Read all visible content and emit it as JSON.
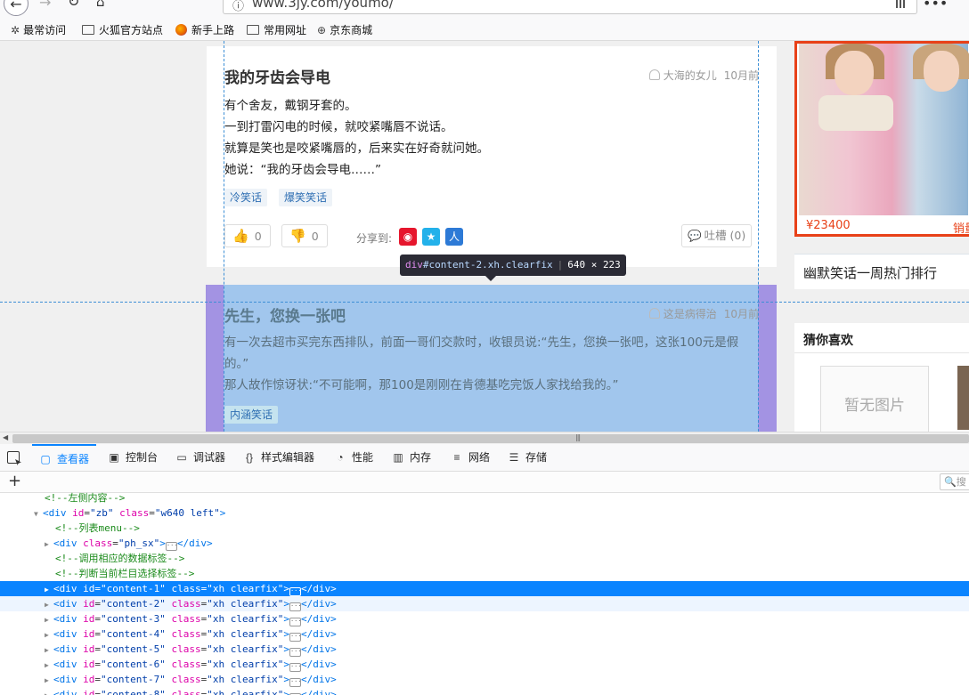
{
  "browser": {
    "url": "www.3jy.com/youmo/",
    "bookmarks": [
      "最常访问",
      "火狐官方站点",
      "新手上路",
      "常用网址",
      "京东商城"
    ]
  },
  "jokes": [
    {
      "title": "我的牙齿会导电",
      "author": "大海的女儿",
      "time": "10月前",
      "lines": [
        "有个舍友，戴钢牙套的。",
        "一到打雷闪电的时候，就咬紧嘴唇不说话。",
        "就算是笑也是咬紧嘴唇的，后来实在好奇就问她。",
        "她说：“我的牙齿会导电……”"
      ],
      "tags": [
        "冷笑话",
        "爆笑笑话"
      ],
      "likes": "0",
      "dislikes": "0",
      "share_label": "分享到:",
      "comment_label": "吐槽 (0)"
    },
    {
      "title": "先生，您换一张吧",
      "author": "这是病得治",
      "time": "10月前",
      "lines": [
        "有一次去超市买完东西排队，前面一哥们交款时，收银员说:“先生，您换一张吧，这张100元是假的。”",
        "那人故作惊讶状:“不可能啊，那100是刚刚在肯德基吃完饭人家找给我的。”"
      ],
      "tags": [
        "内涵笑话"
      ]
    }
  ],
  "tooltip": {
    "tag": "div",
    "selector": "#content-2.xh.clearfix",
    "size": "640 × 223"
  },
  "sidebar": {
    "ad_price": "¥23400",
    "ad_sales": "销量",
    "hot_title": "幽默笑话一周热门排行",
    "guess_title": "猜你喜欢",
    "no_image": "暂无图片"
  },
  "devtools": {
    "tabs": [
      "查看器",
      "控制台",
      "调试器",
      "样式编辑器",
      "性能",
      "内存",
      "网络",
      "存储"
    ],
    "search_placeholder": "搜",
    "tree": [
      {
        "type": "comment",
        "text": "<!--左侧内容-->",
        "indent": 50
      },
      {
        "type": "open",
        "tag": "div",
        "attrs": [
          [
            "id",
            "zb"
          ],
          [
            "class",
            "w640 left"
          ]
        ],
        "indent": 38,
        "expanded": true
      },
      {
        "type": "comment",
        "text": "<!--列表menu-->",
        "indent": 62
      },
      {
        "type": "collapsed",
        "tag": "div",
        "attrs": [
          [
            "class",
            "ph_sx"
          ]
        ],
        "indent": 50
      },
      {
        "type": "comment",
        "text": "<!--调用相应的数据标签-->",
        "indent": 62
      },
      {
        "type": "comment",
        "text": "<!--判断当前栏目选择标签-->",
        "indent": 62
      },
      {
        "type": "collapsed",
        "tag": "div",
        "attrs": [
          [
            "id",
            "content-1"
          ],
          [
            "class",
            "xh clearfix"
          ]
        ],
        "indent": 50,
        "selected": true
      },
      {
        "type": "collapsed",
        "tag": "div",
        "attrs": [
          [
            "id",
            "content-2"
          ],
          [
            "class",
            "xh clearfix"
          ]
        ],
        "indent": 50,
        "hover": true
      },
      {
        "type": "collapsed",
        "tag": "div",
        "attrs": [
          [
            "id",
            "content-3"
          ],
          [
            "class",
            "xh clearfix"
          ]
        ],
        "indent": 50
      },
      {
        "type": "collapsed",
        "tag": "div",
        "attrs": [
          [
            "id",
            "content-4"
          ],
          [
            "class",
            "xh clearfix"
          ]
        ],
        "indent": 50
      },
      {
        "type": "collapsed",
        "tag": "div",
        "attrs": [
          [
            "id",
            "content-5"
          ],
          [
            "class",
            "xh clearfix"
          ]
        ],
        "indent": 50
      },
      {
        "type": "collapsed",
        "tag": "div",
        "attrs": [
          [
            "id",
            "content-6"
          ],
          [
            "class",
            "xh clearfix"
          ]
        ],
        "indent": 50
      },
      {
        "type": "collapsed",
        "tag": "div",
        "attrs": [
          [
            "id",
            "content-7"
          ],
          [
            "class",
            "xh clearfix"
          ]
        ],
        "indent": 50
      },
      {
        "type": "collapsed",
        "tag": "div",
        "attrs": [
          [
            "id",
            "content-8"
          ],
          [
            "class",
            "xh clearfix"
          ]
        ],
        "indent": 50
      }
    ]
  },
  "colors": {
    "accent": "#0a84ff",
    "ad_border": "#e84118",
    "highlight_margin": "#8c78dc",
    "highlight_box": "#a0d7f0"
  }
}
